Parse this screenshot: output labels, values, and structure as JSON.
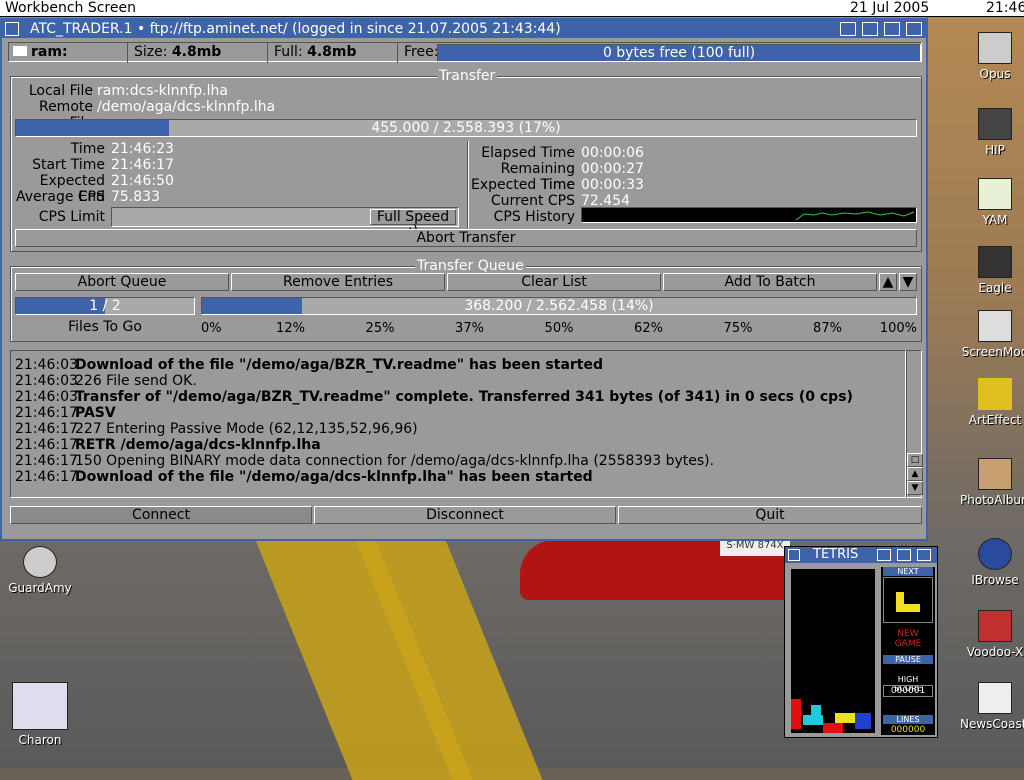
{
  "screen": {
    "title": "Workbench Screen",
    "date": "21 Jul 2005",
    "time": "21:46"
  },
  "desktop_icons": [
    {
      "label": "Opus"
    },
    {
      "label": "HIP"
    },
    {
      "label": "YAM"
    },
    {
      "label": "Eagle"
    },
    {
      "label": "ScreenMod"
    },
    {
      "label": "ArtEffect"
    },
    {
      "label": "PhotoAlbum"
    },
    {
      "label": "IBrowse"
    },
    {
      "label": "Voodoo-X"
    },
    {
      "label": "NewsCoaster"
    },
    {
      "label": "GuardAmy"
    },
    {
      "label": "Charon"
    }
  ],
  "car_plate": "S·MW 874X",
  "window": {
    "title": "ATC_TRADER.1 • ftp://ftp.aminet.net/ (logged in since 21.07.2005 21:43:44)",
    "info": {
      "device": "ram:",
      "size_label": "Size:",
      "size": "4.8mb",
      "full_label": "Full:",
      "full": "4.8mb",
      "free_label": "Free:",
      "free_bar": "0 bytes free (100 full)",
      "free_percent": 100
    },
    "transfer": {
      "title": "Transfer",
      "local_label": "Local File",
      "local": "ram:dcs-klnnfp.lha",
      "remote_label": "Remote File",
      "remote": "/demo/aga/dcs-klnnfp.lha",
      "progress_text": "455.000 / 2.558.393 (17%)",
      "progress_percent": 17,
      "time_label": "Time",
      "time": "21:46:23",
      "start_label": "Start Time",
      "start": "21:46:17",
      "expend_label": "Expected End",
      "expend": "21:46:50",
      "avgcps_label": "Average CPS",
      "avgcps": "75.833",
      "cpslimit_label": "CPS Limit",
      "cpslimit_button": "Full Speed ;)",
      "elapsed_label": "Elapsed Time",
      "elapsed": "00:00:06",
      "remaining_label": "Remaining Time",
      "remaining": "00:00:27",
      "exptime_label": "Expected Time",
      "exptime": "00:00:33",
      "curcps_label": "Current CPS",
      "curcps": "72.454",
      "cpshist_label": "CPS History",
      "abort_button": "Abort Transfer"
    },
    "queue": {
      "title": "Transfer Queue",
      "buttons": [
        "Abort Queue",
        "Remove Entries",
        "Clear List",
        "Add To Batch"
      ],
      "files_progress": "1 / 2",
      "files_percent": 50,
      "files_label": "Files To Go",
      "total_progress": "368.200 / 2.562.458 (14%)",
      "total_percent": 14,
      "ticks": [
        "0%",
        "12%",
        "25%",
        "37%",
        "50%",
        "62%",
        "75%",
        "87%",
        "100%"
      ]
    },
    "log": [
      {
        "time": "21:46:03",
        "text": "Download of the file \"/demo/aga/BZR_TV.readme\" has been started",
        "bold": true
      },
      {
        "time": "21:46:03",
        "text": "226 File send OK.",
        "bold": false
      },
      {
        "time": "21:46:03",
        "text": "Transfer of \"/demo/aga/BZR_TV.readme\" complete. Transferred 341 bytes (of 341) in 0 secs (0 cps)",
        "bold": true
      },
      {
        "time": "21:46:17",
        "text": "PASV",
        "bold": true
      },
      {
        "time": "21:46:17",
        "text": "227 Entering Passive Mode (62,12,135,52,96,96)",
        "bold": false
      },
      {
        "time": "21:46:17",
        "text": "RETR /demo/aga/dcs-klnnfp.lha",
        "bold": true
      },
      {
        "time": "21:46:17",
        "text": "150 Opening BINARY mode data connection for /demo/aga/dcs-klnnfp.lha (2558393 bytes).",
        "bold": false
      },
      {
        "time": "21:46:17",
        "text": "Download of the file \"/demo/aga/dcs-klnnfp.lha\" has been started",
        "bold": true
      }
    ],
    "bottom_buttons": [
      "Connect",
      "Disconnect",
      "Quit"
    ]
  },
  "tetris": {
    "title": "TETRIS",
    "next_label": "NEXT",
    "new_game": "NEW GAME",
    "pause": "PAUSE",
    "highscore_label": "HIGH SCORE",
    "highscore": "000001",
    "lines_label": "LINES",
    "lines": "000000"
  }
}
